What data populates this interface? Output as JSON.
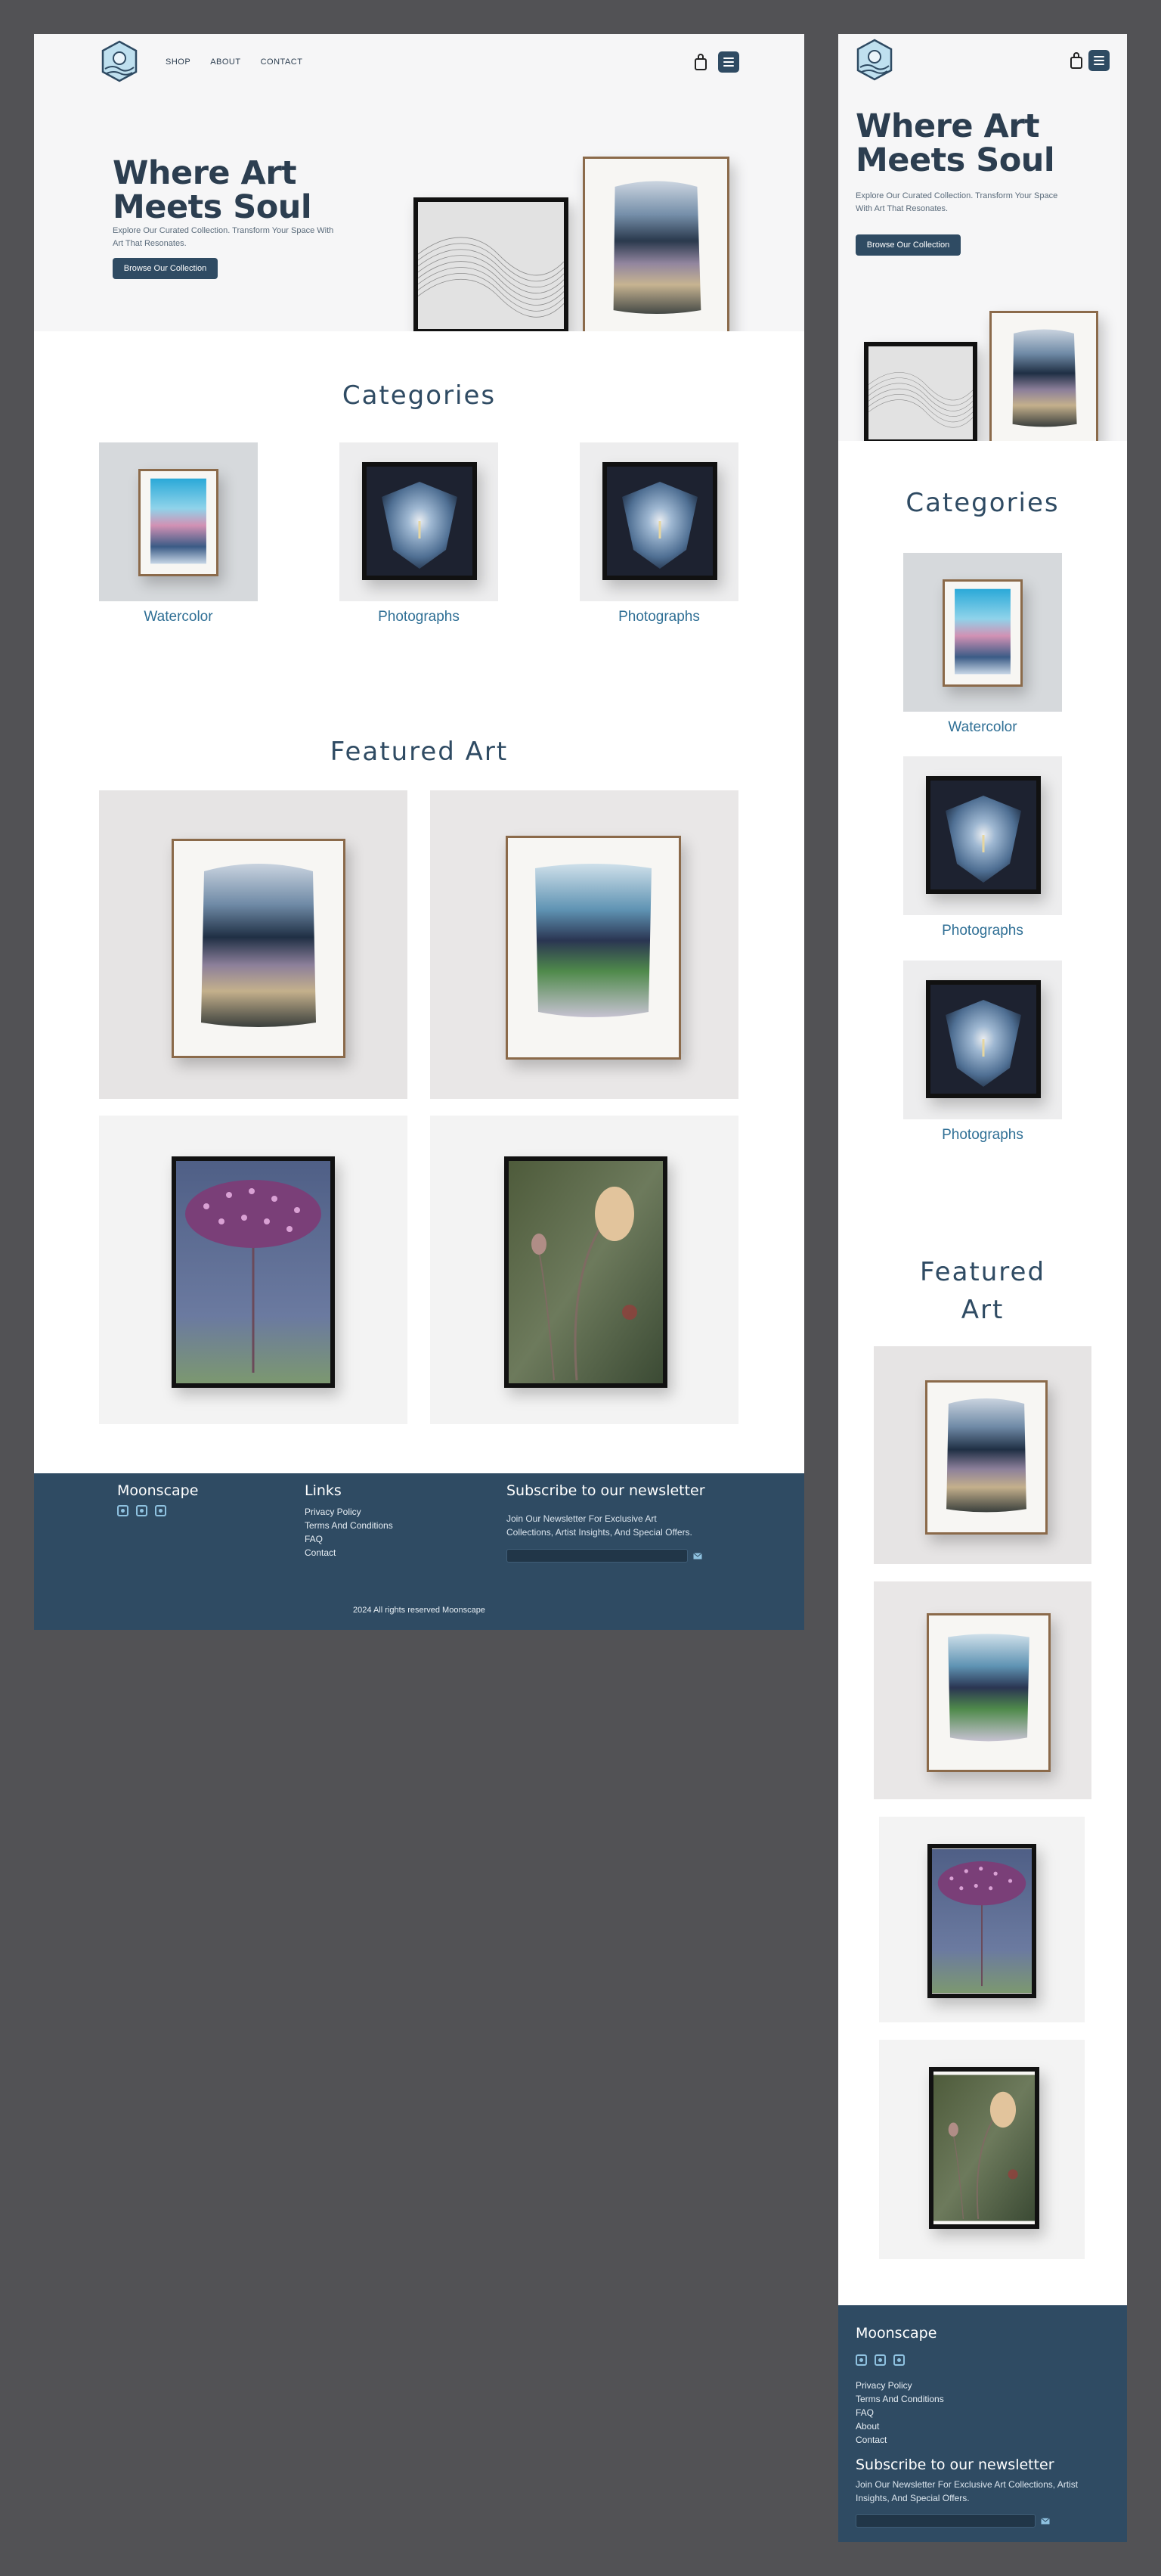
{
  "nav": {
    "links": [
      "SHOP",
      "ABOUT",
      "CONTACT"
    ]
  },
  "hero": {
    "title_line1": "Where Art",
    "title_line2": "Meets Soul",
    "subtitle_line1": "Explore Our Curated Collection. Transform Your Space With",
    "subtitle_line2": "Art That Resonates.",
    "subtitle_m_line1": "Explore Our Curated Collection. Transform Your Space",
    "subtitle_m_line2": "With Art That Resonates.",
    "cta_label": "Browse Our Collection"
  },
  "categories": {
    "title": "Categories",
    "items": [
      {
        "label": "Watercolor"
      },
      {
        "label": "Photographs"
      },
      {
        "label": "Photographs"
      }
    ]
  },
  "featured": {
    "title": "Featured Art",
    "title_m_line1": "Featured",
    "title_m_line2": "Art"
  },
  "footer": {
    "brand": "Moonscape",
    "links_title": "Links",
    "links": [
      "Privacy Policy",
      "Terms And Conditions",
      "FAQ",
      "Contact"
    ],
    "links_mobile": [
      "Privacy Policy",
      "Terms And Conditions",
      "FAQ",
      "About",
      "Contact"
    ],
    "newsletter_title": "Subscribe to our newsletter",
    "newsletter_text_line1": "Join Our Newsletter For Exclusive Art",
    "newsletter_text_line2": "Collections, Artist Insights, And Special Offers.",
    "newsletter_m_line1": "Join Our Newsletter For Exclusive Art Collections, Artist",
    "newsletter_m_line2": "Insights, And Special Offers.",
    "copyright": "2024 All rights reserved Moonscape"
  },
  "colors": {
    "primary": "#2f4b63",
    "accent": "#2f6f95",
    "hero_bg": "#f6f6f7",
    "page_bg": "#525255"
  }
}
